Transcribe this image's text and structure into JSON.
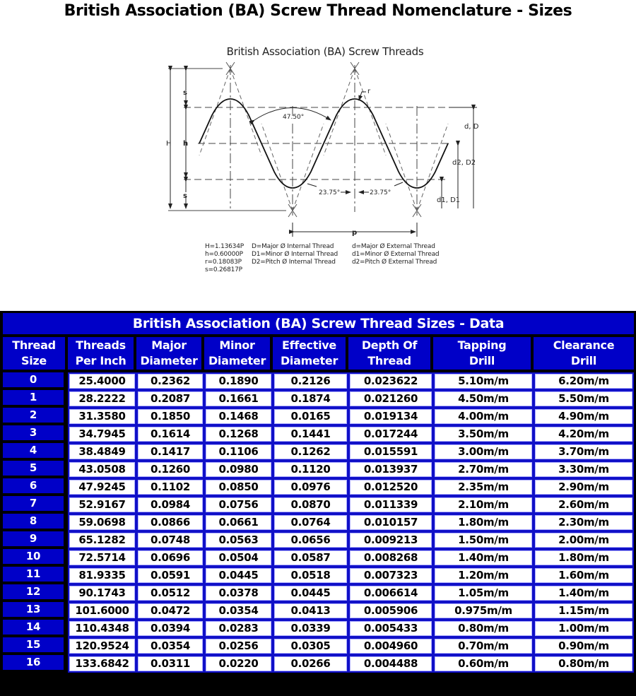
{
  "page": {
    "title": "British Association (BA) Screw Thread Nomenclature - Sizes"
  },
  "diagram": {
    "title": "British Association (BA) Screw Threads",
    "labels": {
      "H": "H",
      "h": "h",
      "s_top": "s",
      "s_bottom": "s",
      "r": "r",
      "angle_total": "47.50°",
      "angle_half_left": "23.75°",
      "angle_half_right": "23.75°",
      "major": "d, D",
      "pitch_dia": "d2, D2",
      "minor": "d1, D1",
      "pitch": "p"
    },
    "legend": {
      "formulas": [
        "H=1.13634P",
        "h=0.60000P",
        "r=0.18083P",
        "s=0.26817P"
      ],
      "internal": [
        "D=Major Ø Internal Thread",
        "D1=Minor Ø Internal Thread",
        "D2=Pitch Ø Internal Thread"
      ],
      "external": [
        "d=Major Ø External Thread",
        "d1=Minor Ø External Thread",
        "d2=Pitch Ø External Thread"
      ]
    }
  },
  "table": {
    "caption": "British Association (BA) Screw Thread Sizes - Data",
    "headers": [
      [
        "Thread",
        "Size"
      ],
      [
        "Threads",
        "Per Inch"
      ],
      [
        "Major",
        "Diameter"
      ],
      [
        "Minor",
        "Diameter"
      ],
      [
        "Effective",
        "Diameter"
      ],
      [
        "Depth Of",
        "Thread"
      ],
      [
        "Tapping",
        "Drill"
      ],
      [
        "Clearance",
        "Drill"
      ]
    ],
    "rows": [
      [
        "0",
        "25.4000",
        "0.2362",
        "0.1890",
        "0.2126",
        "0.023622",
        "5.10m/m",
        "6.20m/m"
      ],
      [
        "1",
        "28.2222",
        "0.2087",
        "0.1661",
        "0.1874",
        "0.021260",
        "4.50m/m",
        "5.50m/m"
      ],
      [
        "2",
        "31.3580",
        "0.1850",
        "0.1468",
        "0.0165",
        "0.019134",
        "4.00m/m",
        "4.90m/m"
      ],
      [
        "3",
        "34.7945",
        "0.1614",
        "0.1268",
        "0.1441",
        "0.017244",
        "3.50m/m",
        "4.20m/m"
      ],
      [
        "4",
        "38.4849",
        "0.1417",
        "0.1106",
        "0.1262",
        "0.015591",
        "3.00m/m",
        "3.70m/m"
      ],
      [
        "5",
        "43.0508",
        "0.1260",
        "0.0980",
        "0.1120",
        "0.013937",
        "2.70m/m",
        "3.30m/m"
      ],
      [
        "6",
        "47.9245",
        "0.1102",
        "0.0850",
        "0.0976",
        "0.012520",
        "2.35m/m",
        "2.90m/m"
      ],
      [
        "7",
        "52.9167",
        "0.0984",
        "0.0756",
        "0.0870",
        "0.011339",
        "2.10m/m",
        "2.60m/m"
      ],
      [
        "8",
        "59.0698",
        "0.0866",
        "0.0661",
        "0.0764",
        "0.010157",
        "1.80m/m",
        "2.30m/m"
      ],
      [
        "9",
        "65.1282",
        "0.0748",
        "0.0563",
        "0.0656",
        "0.009213",
        "1.50m/m",
        "2.00m/m"
      ],
      [
        "10",
        "72.5714",
        "0.0696",
        "0.0504",
        "0.0587",
        "0.008268",
        "1.40m/m",
        "1.80m/m"
      ],
      [
        "11",
        "81.9335",
        "0.0591",
        "0.0445",
        "0.0518",
        "0.007323",
        "1.20m/m",
        "1.60m/m"
      ],
      [
        "12",
        "90.1743",
        "0.0512",
        "0.0378",
        "0.0445",
        "0.006614",
        "1.05m/m",
        "1.40m/m"
      ],
      [
        "13",
        "101.6000",
        "0.0472",
        "0.0354",
        "0.0413",
        "0.005906",
        "0.975m/m",
        "1.15m/m"
      ],
      [
        "14",
        "110.4348",
        "0.0394",
        "0.0283",
        "0.0339",
        "0.005433",
        "0.80m/m",
        "1.00m/m"
      ],
      [
        "15",
        "120.9524",
        "0.0354",
        "0.0256",
        "0.0305",
        "0.004960",
        "0.70m/m",
        "0.90m/m"
      ],
      [
        "16",
        "133.6842",
        "0.0311",
        "0.0220",
        "0.0266",
        "0.004488",
        "0.60m/m",
        "0.80m/m"
      ]
    ]
  },
  "colors": {
    "header_blue": "#0000c8",
    "frame_black": "#000000",
    "cell_white": "#ffffff",
    "grid_blue": "#1010c8"
  }
}
